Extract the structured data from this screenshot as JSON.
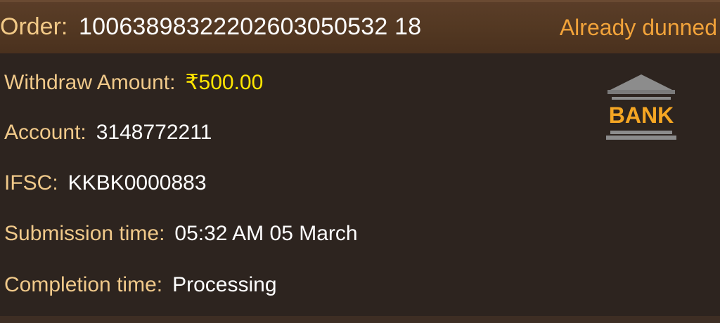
{
  "order": {
    "label": "Order:",
    "number": "10063898322202603050532 18",
    "status": "Already dunned"
  },
  "details": {
    "withdraw_amount_label": "Withdraw Amount:",
    "withdraw_amount_value": "₹500.00",
    "account_label": "Account:",
    "account_value": "3148772211",
    "ifsc_label": "IFSC:",
    "ifsc_value": "KKBK0000883",
    "submission_label": "Submission time:",
    "submission_value": "05:32 AM 05 March",
    "completion_label": "Completion time:",
    "completion_value": "Processing"
  },
  "bank_icon": {
    "name": "bank-icon",
    "text": "BANK",
    "text_color": "#f5a623",
    "body_color": "#8a8a8a"
  },
  "colors": {
    "label": "#f0c98a",
    "value": "#ffffff",
    "amount": "#ffe600",
    "status": "#f2a33a",
    "background": "#2d241f",
    "header": "#553a24"
  }
}
